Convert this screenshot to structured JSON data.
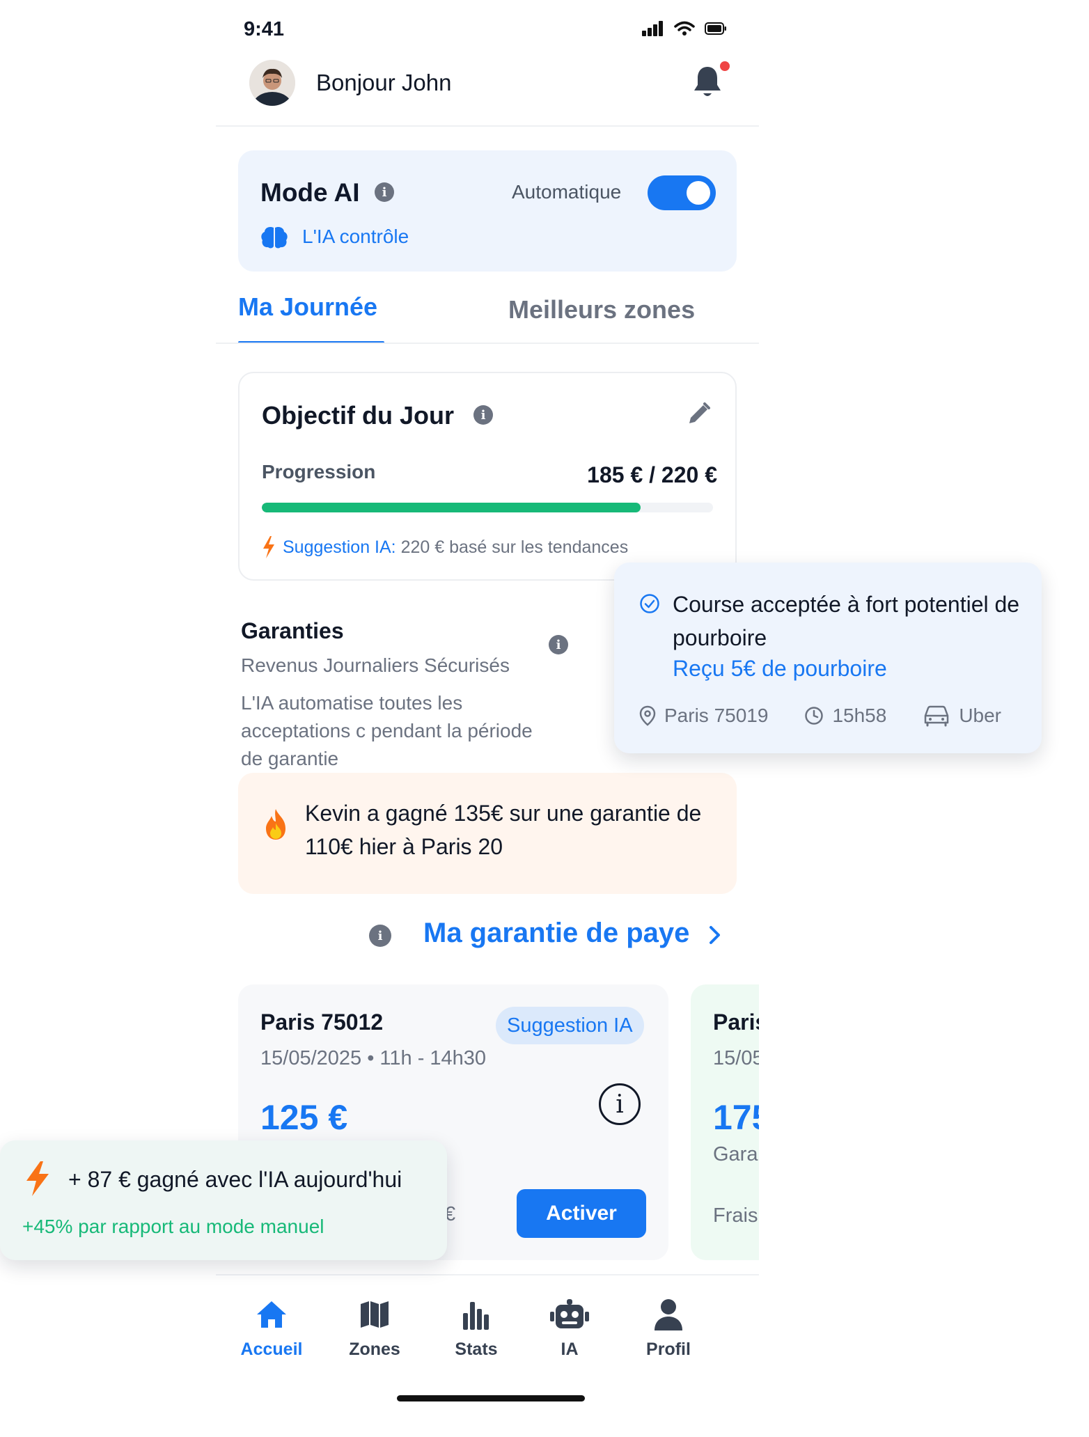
{
  "status_bar": {
    "time": "9:41"
  },
  "header": {
    "greeting": "Bonjour John"
  },
  "mode_ai": {
    "title": "Mode AI",
    "mode_label": "Automatique",
    "toggle_on": true,
    "status": "L'IA contrôle"
  },
  "tabs": [
    {
      "label": "Ma Journée",
      "active": true
    },
    {
      "label": "Meilleurs zones",
      "active": false
    }
  ],
  "objective": {
    "title": "Objectif du Jour",
    "progress_label": "Progression",
    "progress_value": "185 € / 220 €",
    "progress_fraction": 0.84,
    "suggestion_label": "Suggestion IA:",
    "suggestion_text": "220 € basé sur les tendances"
  },
  "garanties": {
    "title": "Garanties",
    "subtitle": "Revenus Journaliers Sécurisés",
    "description": "L'IA automatise toutes les acceptations c pendant la période de garantie"
  },
  "kevin_banner": {
    "text": "Kevin a gagné 135€ sur une garantie de 110€ hier à Paris 20"
  },
  "guarantee_link": {
    "label": "Ma garantie de paye"
  },
  "guarantee_cards": [
    {
      "city": "Paris 75012",
      "badge": "Suggestion IA",
      "date": "15/05/2025 • 11h - 14h30",
      "price": "125 €",
      "partial": "€",
      "button": "Activer"
    },
    {
      "city": "Paris",
      "date": "15/05",
      "price": "175",
      "line2": "Garan",
      "line3": "Frais"
    }
  ],
  "toast_right": {
    "title": "Course acceptée à fort potentiel de pourboire",
    "link": "Reçu 5€ de pourboire",
    "location": "Paris 75019",
    "time": "15h58",
    "app": "Uber"
  },
  "toast_left": {
    "title": "+ 87 € gagné avec l'IA aujourd'hui",
    "subtitle": "+45% par rapport au mode manuel"
  },
  "nav": [
    {
      "label": "Accueil",
      "icon": "home-icon",
      "active": true
    },
    {
      "label": "Zones",
      "icon": "map-icon",
      "active": false
    },
    {
      "label": "Stats",
      "icon": "bar-chart-icon",
      "active": false
    },
    {
      "label": "IA",
      "icon": "robot-icon",
      "active": false
    },
    {
      "label": "Profil",
      "icon": "user-icon",
      "active": false
    }
  ],
  "colors": {
    "accent": "#1877f2",
    "success": "#17b978",
    "alert": "#ef4444",
    "bolt": "#f97316"
  }
}
